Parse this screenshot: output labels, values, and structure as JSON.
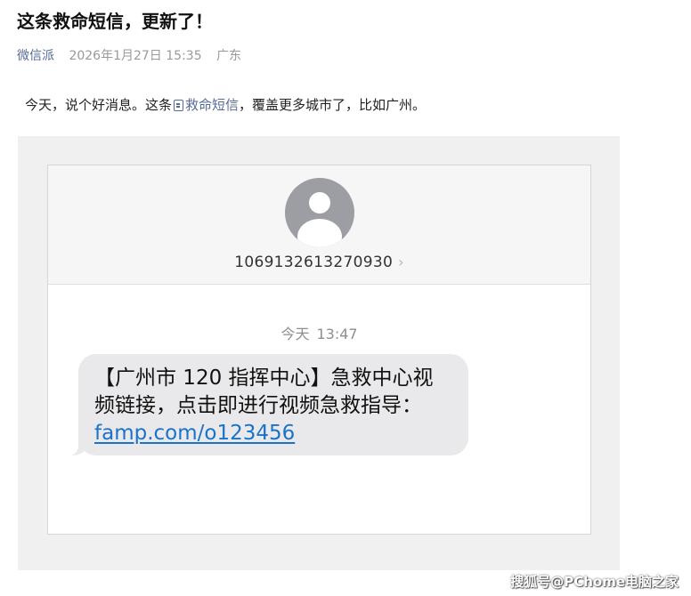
{
  "article": {
    "title": "这条救命短信，更新了！",
    "author": "微信派",
    "date": "2026年1月27日 15:35",
    "location": "广东",
    "intro_before": "今天，说个好消息。这条",
    "intro_link": "救命短信",
    "intro_after": "，覆盖更多城市了，比如广州。",
    "link_color": "#576b95"
  },
  "sms": {
    "sender": "1069132613270930",
    "time_day": "今天",
    "time_clock": "13:47",
    "message_line1": "【广州市 120 指挥中心】急救中心视",
    "message_line2": "频链接，点击即进行视频急救指导：",
    "message_url": "famp.com/o123456",
    "bubble_color": "#e9e9eb",
    "link_color": "#1a73c8"
  },
  "watermark": "搜狐号@PChome电脑之家"
}
